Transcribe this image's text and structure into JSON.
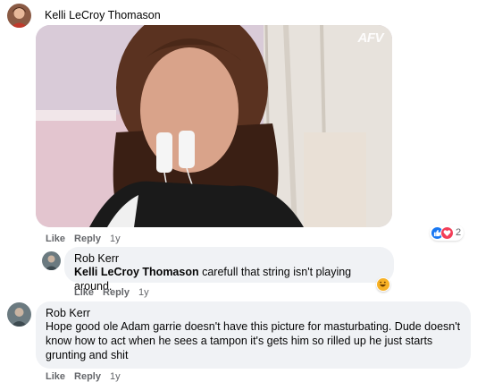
{
  "post": {
    "author": "Kelli LeCroy Thomason",
    "image_watermark": "AFV",
    "actions": {
      "like": "Like",
      "reply": "Reply",
      "time": "1y"
    },
    "reaction_count": "2",
    "reaction_icons": [
      "like-icon",
      "love-icon"
    ]
  },
  "comments": [
    {
      "author": "Rob Kerr",
      "mention": "Kelli LeCroy Thomason",
      "text": " carefull that string isn't playing around.",
      "actions": {
        "like": "Like",
        "reply": "Reply",
        "time": "1y"
      },
      "reaction_icon": "laugh-icon"
    },
    {
      "author": "Rob Kerr",
      "text": "Hope good ole Adam garrie doesn't have this picture for masturbating. Dude doesn't know how to act when he sees a tampon it's gets him so rilled up he just starts grunting and shit",
      "actions": {
        "like": "Like",
        "reply": "Reply",
        "time": "1y"
      }
    }
  ],
  "colors": {
    "bubble_bg": "#f0f2f5",
    "meta_text": "#65676b",
    "like_blue": "#1877f2",
    "love_red": "#f33e58",
    "haha_yellow": "#f7b125"
  }
}
